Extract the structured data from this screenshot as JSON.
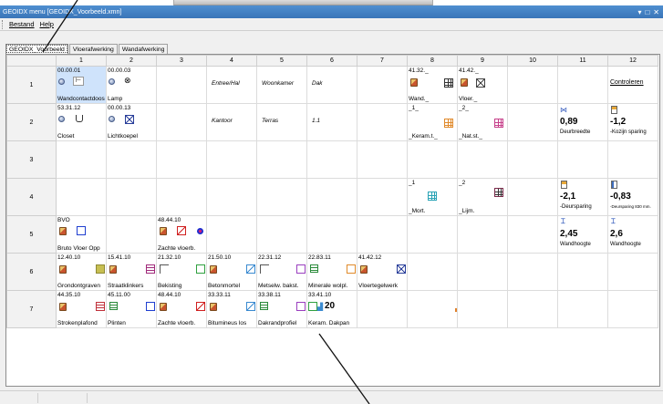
{
  "window": {
    "title": "GEOIDX menu [GEOIDX_Voorbeeld.xmn]",
    "controls": [
      "▾",
      "□",
      "✕"
    ]
  },
  "menu": {
    "items": [
      "Bestand",
      "Help"
    ]
  },
  "tabs": [
    {
      "label": "GEOIDX_Voorbeeld",
      "active": true
    },
    {
      "label": "Vloerafwerking",
      "active": false
    },
    {
      "label": "Wandafwerking",
      "active": false
    }
  ],
  "grid": {
    "columns": [
      "1",
      "2",
      "3",
      "4",
      "5",
      "6",
      "7",
      "8",
      "9",
      "10",
      "11",
      "12"
    ],
    "rows": [
      "1",
      "2",
      "3",
      "4",
      "5",
      "6",
      "7"
    ],
    "cells": {
      "r1c1": {
        "code": "00.00.01",
        "name": "Wandcontactdoos"
      },
      "r1c2": {
        "code": "00.00.03",
        "name": "Lamp"
      },
      "r1c4": {
        "text": "Entree/Hal"
      },
      "r1c5": {
        "text": "Woonkamer"
      },
      "r1c6": {
        "text": "Dak"
      },
      "r1c8": {
        "code": "41.32._",
        "name": "Wand._"
      },
      "r1c9": {
        "code": "41.42._",
        "name": "Vloer._"
      },
      "r1c12": {
        "text": "Controleren"
      },
      "r2c1": {
        "code": "53.31.12",
        "name": "Closet"
      },
      "r2c2": {
        "code": "00.00.13",
        "name": "Lichtkoepel"
      },
      "r2c4": {
        "text": "Kantoor"
      },
      "r2c5": {
        "text": "Terras"
      },
      "r2c6": {
        "text": "1.1"
      },
      "r2c8": {
        "code": "_1_",
        "name": "_Keram.t._"
      },
      "r2c9": {
        "code": "_2_",
        "name": "_Nat.st._"
      },
      "r2c11": {
        "value": "0,89",
        "caption": "Deurbreedte"
      },
      "r2c12": {
        "value": "-1,2",
        "caption": "-Kozijn sparing"
      },
      "r4c8": {
        "code": "_1",
        "name": "_Mort."
      },
      "r4c9": {
        "code": "_2",
        "name": "_Lijm."
      },
      "r4c11": {
        "value": "-2,1",
        "caption": "-Deursparing"
      },
      "r4c12": {
        "value": "-0,83",
        "caption": "-Deursparing 830 mm."
      },
      "r5c1": {
        "code": "BVO",
        "name": "Bruto Vloer Opp"
      },
      "r5c3": {
        "code": "48.44.10",
        "name": "Zachte vloerb."
      },
      "r5c11": {
        "value": "2,45",
        "caption": "Wandhoogte"
      },
      "r5c12": {
        "value": "2,6",
        "caption": "Wandhoogte"
      },
      "r6c1": {
        "code": "12.40.10",
        "name": "Grondontgraven"
      },
      "r6c2": {
        "code": "15.41.10",
        "name": "Straatklinkers"
      },
      "r6c3": {
        "code": "21.32.10",
        "name": "Bekisting"
      },
      "r6c4": {
        "code": "21.50.10",
        "name": "Betonmortel"
      },
      "r6c5": {
        "code": "22.31.12",
        "name": "Metselw. bakst."
      },
      "r6c6": {
        "code": "22.83.11",
        "name": "Minerale wolpl."
      },
      "r6c7": {
        "code": "41.42.12",
        "name": "Vloertegelwerk"
      },
      "r7c1": {
        "code": "44.35.10",
        "name": "Strokenplafond"
      },
      "r7c2": {
        "code": "45.11.00",
        "name": "Plinten"
      },
      "r7c3": {
        "code": "48.44.10",
        "name": "Zachte vloerb."
      },
      "r7c4": {
        "code": "33.33.11",
        "name": "Bitumineus los"
      },
      "r7c5": {
        "code": "33.38.11",
        "name": "Dakrandprofiel"
      },
      "r7c6": {
        "code": "33.41.10",
        "name": "Keram. Dakpan",
        "value": "20"
      }
    }
  },
  "icons": {
    "socket": "switch-icon",
    "lamp": "lamp-icon",
    "book": "material-book-icon",
    "tile": "tile-grid-icon",
    "brush": "brush-icon",
    "radiator": "radiator-icon"
  }
}
